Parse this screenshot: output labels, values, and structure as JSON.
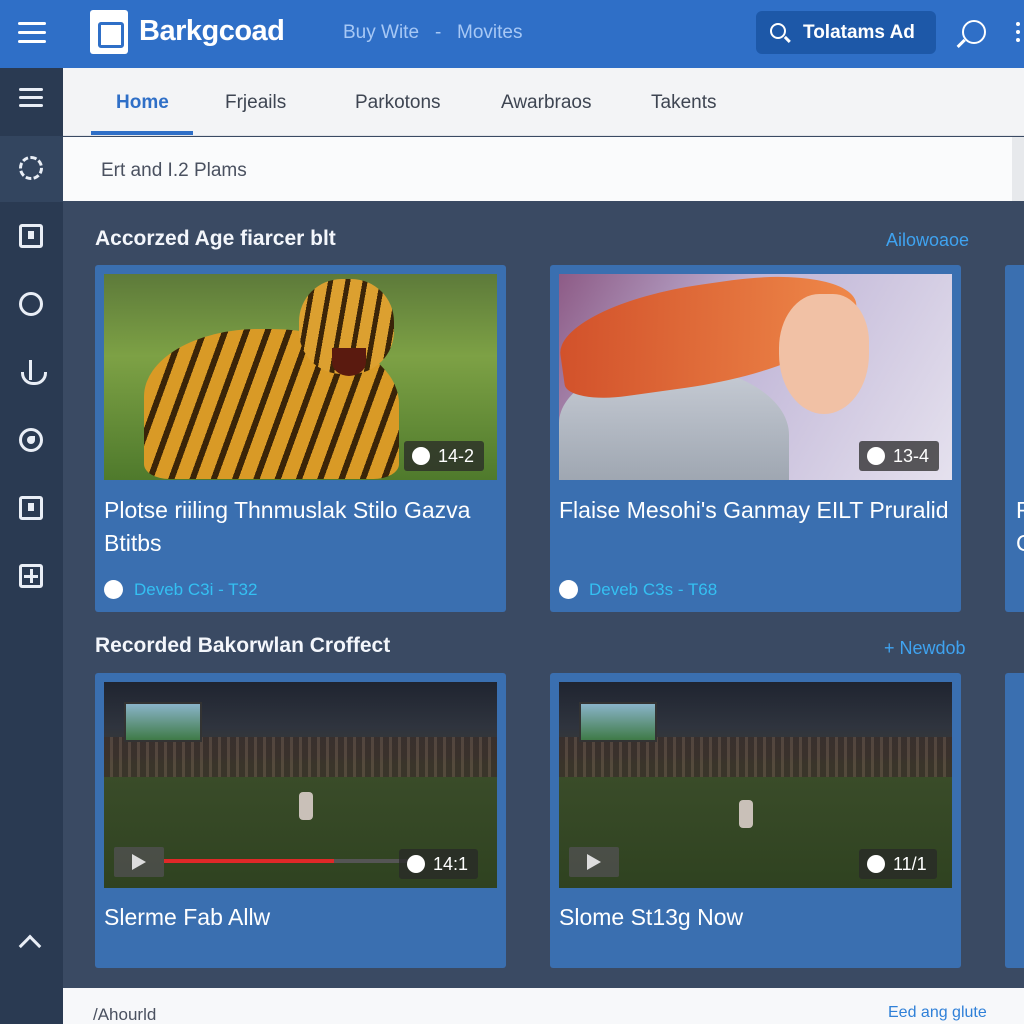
{
  "app": {
    "brand": "Barkgcoad",
    "top_nav": [
      "Buy Wite",
      "Movites"
    ],
    "top_nav_separator": "-",
    "search_button_label": "Tolatams Ad"
  },
  "tabs": [
    {
      "label": "Home",
      "active": true
    },
    {
      "label": "Frjeails",
      "active": false
    },
    {
      "label": "Parkotons",
      "active": false
    },
    {
      "label": "Awarbraos",
      "active": false
    },
    {
      "label": "Takents",
      "active": false
    }
  ],
  "subheader": "Ert and I.2  Plams",
  "sidebar": {
    "items": [
      {
        "icon": "list-icon"
      },
      {
        "icon": "gear-icon",
        "active": true
      },
      {
        "icon": "info-icon"
      },
      {
        "icon": "trophy-icon"
      },
      {
        "icon": "anchor-icon"
      },
      {
        "icon": "drop-icon"
      },
      {
        "icon": "window-icon"
      },
      {
        "icon": "add-icon"
      }
    ]
  },
  "sections": [
    {
      "title": "Accorzed Age fiarcer blt",
      "link": "Ailowoaoe",
      "cards": [
        {
          "title": "Plotse riiling Thnmuslak Stilo Gazva Btitbs",
          "duration": "14-2",
          "meta": "Deveb C3i - T32"
        },
        {
          "title": "Flaise Mesohi's Ganmay EILT Pruralid",
          "duration": "13-4",
          "meta": "Deveb C3s - T68"
        }
      ],
      "peek_letters": [
        "F",
        "C"
      ]
    },
    {
      "title": "Recorded Bakorwlan Croffect",
      "link": "+ Newdob",
      "cards": [
        {
          "title": "Slerme Fab Allw",
          "duration": "14:1",
          "progress": 0.68
        },
        {
          "title": "Slome St13g Now",
          "duration": "11/1"
        }
      ]
    }
  ],
  "footer": {
    "left": "/Ahourld",
    "right": "Eed ang glute"
  },
  "colors": {
    "topbar": "#2f6fc7",
    "sidebar": "#2a3a52",
    "content_bg": "#3a4a63",
    "card": "#3a6fb0",
    "accent_link": "#3fa3f0",
    "meta_text": "#34c0f2"
  }
}
